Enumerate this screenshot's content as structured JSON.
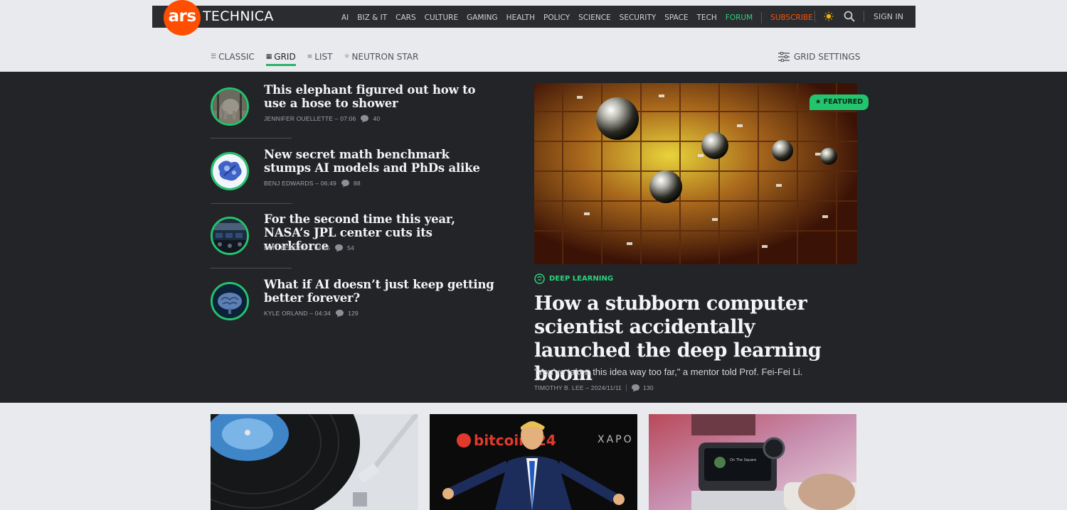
{
  "header": {
    "logo_ars": "ars",
    "logo_word": "TECHNICA",
    "nav": [
      "AI",
      "BIZ & IT",
      "CARS",
      "CULTURE",
      "GAMING",
      "HEALTH",
      "POLICY",
      "SCIENCE",
      "SECURITY",
      "SPACE",
      "TECH"
    ],
    "forum": "FORUM",
    "subscribe": "SUBSCRIBE",
    "signin": "SIGN IN",
    "accent": "#ff4e00",
    "forum_color": "#29d37c"
  },
  "views": {
    "options": [
      {
        "icon": "classic-view-icon",
        "label": "CLASSIC"
      },
      {
        "icon": "grid-view-icon",
        "label": "GRID"
      },
      {
        "icon": "list-view-icon",
        "label": "LIST"
      },
      {
        "icon": "neutron-star-icon",
        "label": "NEUTRON STAR"
      }
    ],
    "active": "GRID",
    "grid_settings": "GRID SETTINGS"
  },
  "stories": [
    {
      "title": "This elephant figured out how to use a hose to shower",
      "author": "JENNIFER OUELLETTE",
      "time": "07:06",
      "comments": "40",
      "thumb": "elephant-thumbnail"
    },
    {
      "title": "New secret math benchmark stumps AI models and PhDs alike",
      "author": "BENJ EDWARDS",
      "time": "06:49",
      "comments": "88",
      "thumb": "math-thumbnail"
    },
    {
      "title": "For the second time this year, NASA’s JPL center cuts its workforce",
      "author": "ERIC BERGER",
      "time": "04:55",
      "comments": "54",
      "thumb": "jpl-thumbnail"
    },
    {
      "title": "What if AI doesn’t just keep getting better forever?",
      "author": "KYLE ORLAND",
      "time": "04:34",
      "comments": "129",
      "thumb": "brain-thumbnail"
    }
  ],
  "featured": {
    "badge": "FEATURED",
    "category": "DEEP LEARNING",
    "title": "How a stubborn computer scientist accidentally launched the deep learning boom",
    "dek": "\"You’ve taken this idea way too far,\" a mentor told Prof. Fei-Fei Li.",
    "author": "TIMOTHY B. LEE",
    "date": "2024/11/11",
    "comments": "130",
    "accent": "#23c46e"
  },
  "cards": [
    {
      "image": "turntable-photo"
    },
    {
      "image": "bitcoin-conference-photo",
      "texts": [
        "bitcoin",
        "24",
        "XAPO"
      ]
    },
    {
      "image": "desk-gadget-photo",
      "screen_text": "On The Square"
    }
  ]
}
